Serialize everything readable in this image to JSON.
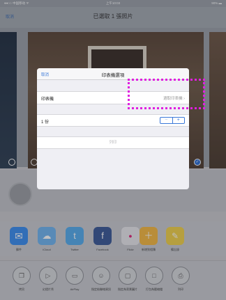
{
  "status_bar": {
    "carrier": "●●○○ 中国移动 ᯤ",
    "time": "上午10:03",
    "battery": "90% ▬"
  },
  "navbar": {
    "cancel_label": "取消",
    "title": "已選取 1 張照片"
  },
  "share_apps": [
    {
      "label": "郵件",
      "color": "#3b8ef0",
      "glyph": "✉"
    },
    {
      "label": "iCloud",
      "color": "#6fb4f0",
      "glyph": "☁"
    },
    {
      "label": "Twitter",
      "color": "#55acee",
      "glyph": "t"
    },
    {
      "label": "Facebook",
      "color": "#3b5998",
      "glyph": "f"
    },
    {
      "label": "Flickr",
      "color": "#e8e8ec",
      "glyph": "●"
    },
    {
      "label": "新增到相簿",
      "color": "#f5b942",
      "glyph": "＋"
    },
    {
      "label": "備忘錄",
      "color": "#f1d24a",
      "glyph": "✎"
    }
  ],
  "actions": [
    {
      "label": "拷貝",
      "glyph": "❐"
    },
    {
      "label": "幻燈片秀",
      "glyph": "▷"
    },
    {
      "label": "AirPlay",
      "glyph": "▭"
    },
    {
      "label": "指定給聯絡資訊",
      "glyph": "☺"
    },
    {
      "label": "指定為背景圖片",
      "glyph": "▢"
    },
    {
      "label": "打包為壓縮檔",
      "glyph": "□"
    },
    {
      "label": "列印",
      "glyph": "⎙"
    }
  ],
  "sheet": {
    "cancel_label": "取消",
    "title": "印表機選項",
    "printer_label": "印表機",
    "printer_value": "選取印表機",
    "chevron": "›",
    "copies_label": "1 份",
    "minus": "−",
    "plus": "+",
    "print_label": "列印"
  },
  "colors": {
    "accent": "#3a78d8",
    "highlight": "#e01ee0"
  }
}
